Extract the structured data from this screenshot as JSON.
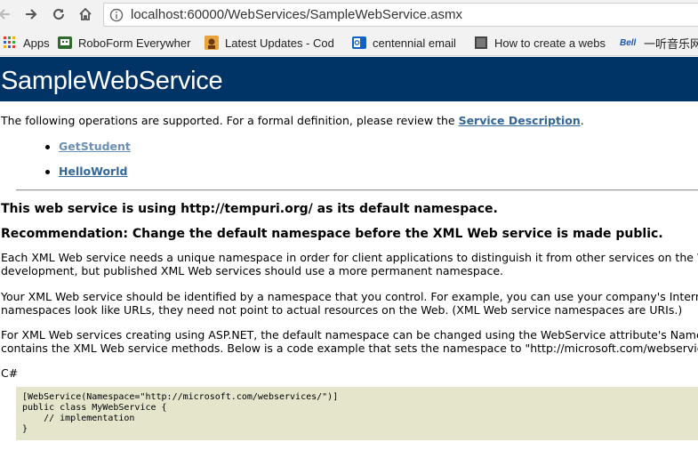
{
  "browser": {
    "url": "localhost:60000/WebServices/SampleWebService.asmx",
    "bookmarks": [
      {
        "label": "Apps",
        "icon": "apps-grid-icon"
      },
      {
        "label": "RoboForm Everywher",
        "icon": "roboform-icon"
      },
      {
        "label": "Latest Updates - Cod",
        "icon": "latest-updates-icon"
      },
      {
        "label": "centennial email",
        "icon": "outlook-icon"
      },
      {
        "label": "How to create a webs",
        "icon": "page-icon"
      },
      {
        "label": "",
        "icon": "bell-icon"
      },
      {
        "label": "一听音乐网",
        "icon": "music-site-icon"
      }
    ],
    "bell_text": "Bell"
  },
  "page": {
    "title": "SampleWebService",
    "intro_text": "The following operations are supported. For a formal definition, please review the ",
    "intro_link": "Service Description",
    "intro_end": ".",
    "operations": [
      "GetStudent",
      "HelloWorld"
    ],
    "namespace_heading": "This web service is using http://tempuri.org/ as its default namespace.",
    "recommendation_heading": "Recommendation: Change the default namespace before the XML Web service is made public.",
    "paragraph1_line1": "Each XML Web service needs a unique namespace in order for client applications to distinguish it from other services on the W",
    "paragraph1_line2": "development, but published XML Web services should use a more permanent namespace.",
    "paragraph2_line1": "Your XML Web service should be identified by a namespace that you control. For example, you can use your company's Intern",
    "paragraph2_line2": "namespaces look like URLs, they need not point to actual resources on the Web. (XML Web service namespaces are URIs.)",
    "paragraph3_line1": "For XML Web services creating using ASP.NET, the default namespace can be changed using the WebService attribute's Names",
    "paragraph3_line2": "contains the XML Web service methods. Below is a code example that sets the namespace to \"http://microsoft.com/webservic",
    "language_label": "C#",
    "code": "[WebService(Namespace=\"http://microsoft.com/webservices/\")]\npublic class MyWebService {\n    // implementation\n}"
  },
  "colors": {
    "banner": "#003366",
    "link": "#336699",
    "code_bg": "#e5e5cc"
  }
}
